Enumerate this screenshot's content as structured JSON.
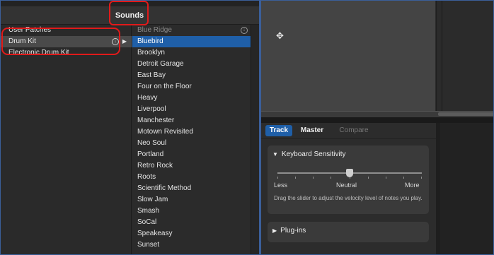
{
  "sounds_header": {
    "title": "Sounds"
  },
  "categories": [
    {
      "label": "User Patches"
    },
    {
      "label": "Drum Kit"
    },
    {
      "label": "Electronic Drum Kit"
    }
  ],
  "kits": [
    {
      "label": "Blue Ridge"
    },
    {
      "label": "Bluebird"
    },
    {
      "label": "Brooklyn"
    },
    {
      "label": "Detroit Garage"
    },
    {
      "label": "East Bay"
    },
    {
      "label": "Four on the Floor"
    },
    {
      "label": "Heavy"
    },
    {
      "label": "Liverpool"
    },
    {
      "label": "Manchester"
    },
    {
      "label": "Motown Revisited"
    },
    {
      "label": "Neo Soul"
    },
    {
      "label": "Portland"
    },
    {
      "label": "Retro Rock"
    },
    {
      "label": "Roots"
    },
    {
      "label": "Scientific Method"
    },
    {
      "label": "Slow Jam"
    },
    {
      "label": "Smash"
    },
    {
      "label": "SoCal"
    },
    {
      "label": "Speakeasy"
    },
    {
      "label": "Sunset"
    }
  ],
  "selected": {
    "category": "Drum Kit",
    "kit": "Bluebird"
  },
  "inspector": {
    "tabs": [
      {
        "label": "Track",
        "active": true
      },
      {
        "label": "Master",
        "active": false
      },
      {
        "label": "Compare",
        "active": false
      }
    ],
    "keyboard_sensitivity": {
      "title": "Keyboard Sensitivity",
      "expanded": true,
      "value_label": "Neutral",
      "level": 0.5,
      "min_label": "Less",
      "mid_label": "Neutral",
      "max_label": "More",
      "description": "Drag the slider to adjust the velocity level of notes you play."
    },
    "plugins": {
      "title": "Plug-ins",
      "expanded": false
    }
  },
  "icons": {
    "download": "download-circle-icon",
    "disclosure": "chevron-right-icon",
    "move": "move-cursor-icon",
    "expanded": "triangle-down-icon",
    "collapsed": "triangle-right-icon"
  },
  "colors": {
    "selection": "#1f5fa8",
    "annotation": "#e11a1a",
    "panel": "#3a3a3a"
  }
}
